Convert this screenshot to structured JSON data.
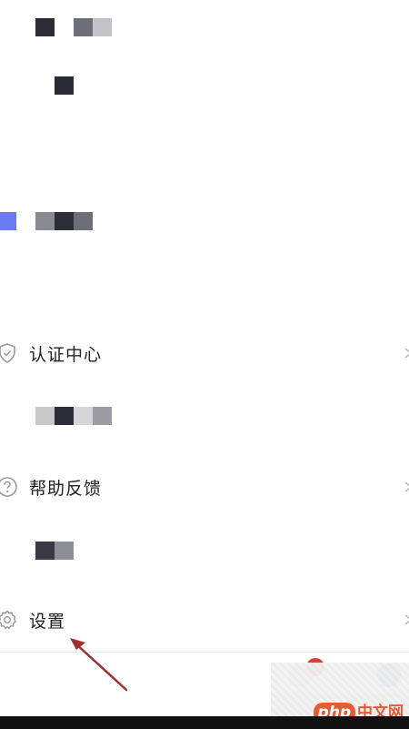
{
  "menu": {
    "items": [
      {
        "label": "认证中心",
        "icon": "shield-check-icon"
      },
      {
        "label": "帮助反馈",
        "icon": "question-circle-icon"
      },
      {
        "label": "设置",
        "icon": "gear-icon"
      }
    ]
  },
  "watermark": {
    "php": "php",
    "cn": "中文网"
  },
  "colors": {
    "accent": "#6a7bf0",
    "badge": "#e4393c",
    "arrow": "#a0302f",
    "watermark": "#e2562b"
  }
}
